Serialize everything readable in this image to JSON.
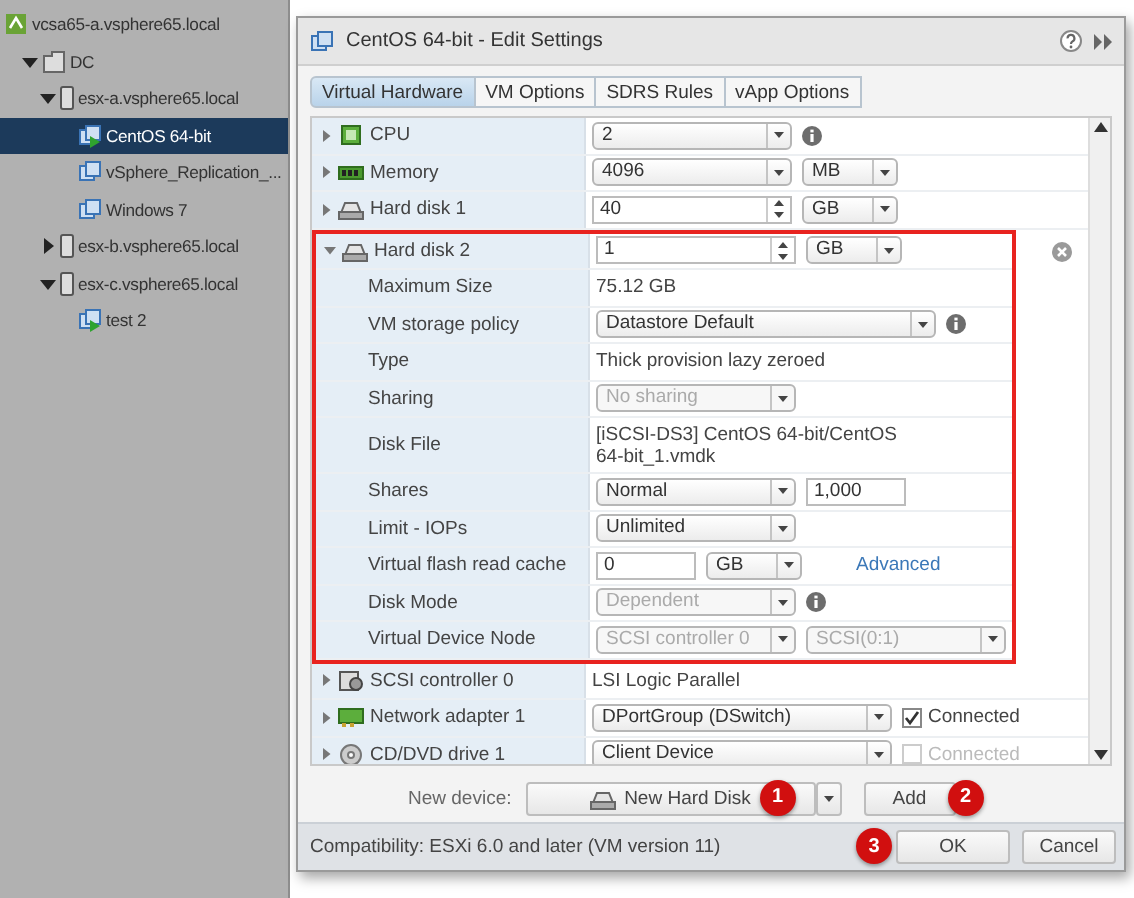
{
  "tree": [
    {
      "label": "vcsa65-a.vsphere65.local",
      "kind": "vcenter",
      "selected": false,
      "children": [
        {
          "label": "DC",
          "kind": "datacenter",
          "expanded": true,
          "selected": false,
          "children": [
            {
              "label": "esx-a.vsphere65.local",
              "kind": "host",
              "expanded": true,
              "selected": false,
              "children": [
                {
                  "label": "CentOS 64-bit",
                  "kind": "vm-on",
                  "selected": true
                },
                {
                  "label": "vSphere_Replication_...",
                  "kind": "vm",
                  "selected": false
                },
                {
                  "label": "Windows 7",
                  "kind": "vm",
                  "selected": false
                }
              ]
            },
            {
              "label": "esx-b.vsphere65.local",
              "kind": "host",
              "expanded": false,
              "selected": false
            },
            {
              "label": "esx-c.vsphere65.local",
              "kind": "host",
              "expanded": true,
              "selected": false,
              "children": [
                {
                  "label": "test 2",
                  "kind": "vm-on",
                  "selected": false
                }
              ]
            }
          ]
        }
      ]
    }
  ],
  "dialog": {
    "title": "CentOS 64-bit - Edit Settings",
    "tabs": [
      {
        "label": "Virtual Hardware",
        "selected": true
      },
      {
        "label": "VM Options",
        "selected": false
      },
      {
        "label": "SDRS Rules",
        "selected": false
      },
      {
        "label": "vApp Options",
        "selected": false
      }
    ],
    "rows": [
      {
        "kind": "cpu",
        "label": "CPU",
        "expanded": false,
        "controls": [
          {
            "kind": "select",
            "value": "2",
            "disabled": false
          },
          {
            "kind": "info"
          }
        ]
      },
      {
        "kind": "memory",
        "label": "Memory",
        "expanded": false,
        "controls": [
          {
            "kind": "select",
            "value": "4096",
            "disabled": false
          },
          {
            "kind": "unit",
            "value": "MB",
            "disabled": false
          }
        ]
      },
      {
        "kind": "disk",
        "label": "Hard disk 1",
        "expanded": false,
        "controls": [
          {
            "kind": "spinner",
            "value": "40"
          },
          {
            "kind": "unit",
            "value": "GB",
            "disabled": false
          }
        ]
      },
      {
        "kind": "disk",
        "label": "Hard disk 2",
        "expanded": true,
        "highlighted": true,
        "removable": true,
        "controls": [
          {
            "kind": "spinner",
            "value": "1"
          },
          {
            "kind": "unit",
            "value": "GB",
            "disabled": false
          }
        ],
        "children": [
          {
            "kind": "property",
            "label": "Maximum Size",
            "controls": [
              {
                "kind": "text",
                "value": "75.12 GB"
              }
            ]
          },
          {
            "kind": "property",
            "label": "VM storage policy",
            "controls": [
              {
                "kind": "wide-select",
                "value": "Datastore Default",
                "disabled": false
              },
              {
                "kind": "info"
              }
            ]
          },
          {
            "kind": "property",
            "label": "Type",
            "controls": [
              {
                "kind": "text",
                "value": "Thick provision lazy zeroed"
              }
            ]
          },
          {
            "kind": "property",
            "label": "Sharing",
            "controls": [
              {
                "kind": "select",
                "value": "No sharing",
                "disabled": true
              }
            ]
          },
          {
            "kind": "property",
            "label": "Disk File",
            "controls": [
              {
                "kind": "text",
                "value": "[iSCSI-DS3] CentOS 64-bit/CentOS 64-bit_1.vmdk"
              }
            ]
          },
          {
            "kind": "property",
            "label": "Shares",
            "controls": [
              {
                "kind": "select",
                "value": "Normal",
                "disabled": false
              },
              {
                "kind": "input",
                "value": "1,000"
              }
            ]
          },
          {
            "kind": "property",
            "label": "Limit - IOPs",
            "controls": [
              {
                "kind": "select",
                "value": "Unlimited",
                "disabled": false
              }
            ]
          },
          {
            "kind": "property",
            "label": "Virtual flash read cache",
            "controls": [
              {
                "kind": "input",
                "value": "0"
              },
              {
                "kind": "unit",
                "value": "GB",
                "disabled": false
              },
              {
                "kind": "link",
                "value": "Advanced"
              }
            ]
          },
          {
            "kind": "property",
            "label": "Disk Mode",
            "controls": [
              {
                "kind": "select",
                "value": "Dependent",
                "disabled": true
              },
              {
                "kind": "info"
              }
            ]
          },
          {
            "kind": "property",
            "label": "Virtual Device Node",
            "controls": [
              {
                "kind": "select",
                "value": "SCSI controller 0",
                "disabled": true
              },
              {
                "kind": "select",
                "value": "SCSI(0:1)",
                "disabled": true
              }
            ]
          }
        ]
      },
      {
        "kind": "controller",
        "label": "SCSI controller 0",
        "expanded": false,
        "controls": [
          {
            "kind": "text",
            "value": "LSI Logic Parallel"
          }
        ]
      },
      {
        "kind": "network",
        "label": "Network adapter 1",
        "expanded": false,
        "controls": [
          {
            "kind": "wide-select",
            "value": "DPortGroup (DSwitch)",
            "disabled": false
          },
          {
            "kind": "checkbox",
            "label": "Connected",
            "checked": true,
            "disabled": false
          }
        ]
      },
      {
        "kind": "cdrom",
        "label": "CD/DVD drive 1",
        "expanded": false,
        "controls": [
          {
            "kind": "wide-select",
            "value": "Client Device",
            "disabled": false
          },
          {
            "kind": "checkbox",
            "label": "Connected",
            "checked": false,
            "disabled": true
          }
        ]
      }
    ],
    "new_device": {
      "label": "New device:",
      "device": "New Hard Disk",
      "device_marker": "1",
      "add": "Add",
      "add_marker": "2"
    },
    "footer": {
      "compatibility": "Compatibility: ESXi 6.0 and later (VM version 11)",
      "ok": "OK",
      "ok_marker": "3",
      "cancel": "Cancel"
    }
  }
}
